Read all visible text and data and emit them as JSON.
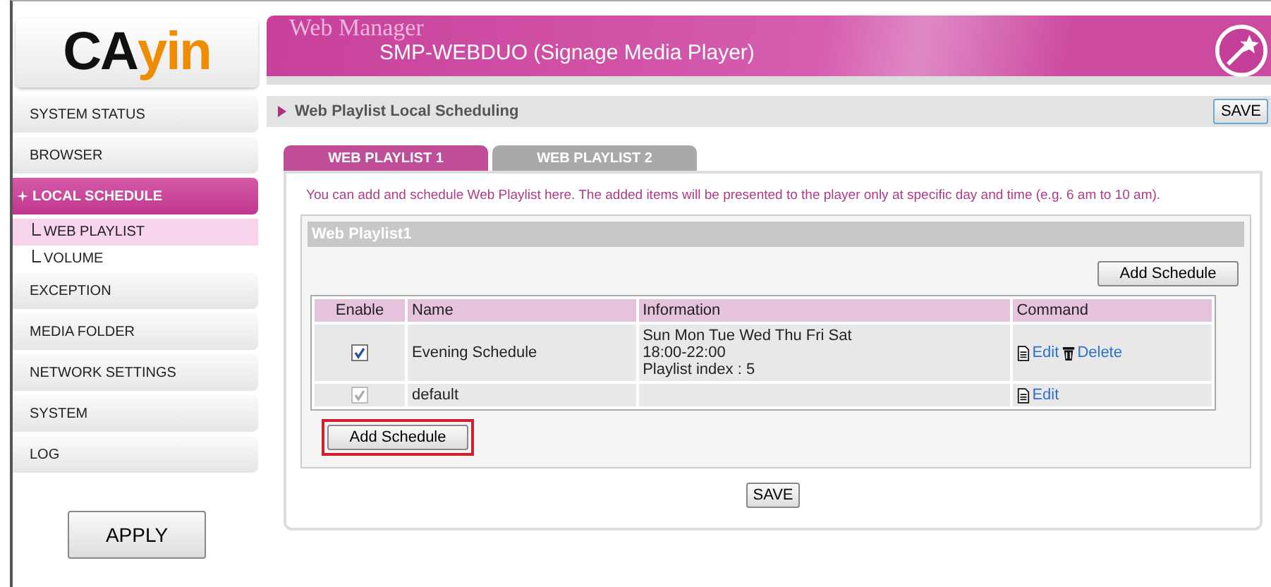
{
  "logo": {
    "parts": [
      "CA",
      "yin"
    ]
  },
  "header": {
    "title": "Web Manager",
    "subtitle": "SMP-WEBDUO (Signage Media Player)"
  },
  "sidebar": {
    "items": [
      {
        "label": "SYSTEM STATUS",
        "selected": false
      },
      {
        "label": "BROWSER",
        "selected": false
      },
      {
        "label": "LOCAL SCHEDULE",
        "selected": true,
        "children": [
          {
            "label": "WEB PLAYLIST",
            "selected": true
          },
          {
            "label": "VOLUME",
            "selected": false
          }
        ]
      },
      {
        "label": "EXCEPTION",
        "selected": false
      },
      {
        "label": "MEDIA FOLDER",
        "selected": false
      },
      {
        "label": "NETWORK SETTINGS",
        "selected": false
      },
      {
        "label": "SYSTEM",
        "selected": false
      },
      {
        "label": "LOG",
        "selected": false
      }
    ],
    "apply_button": "APPLY"
  },
  "page_title": "Web Playlist Local Scheduling",
  "top_save_button": "SAVE",
  "tabs": [
    {
      "label": "WEB PLAYLIST 1",
      "selected": true
    },
    {
      "label": "WEB PLAYLIST 2",
      "selected": false
    }
  ],
  "description": "You can add and schedule Web Playlist here. The added items will be presented to the player only at specific day and time (e.g. 6 am to 10 am).",
  "section_title": "Web Playlist1",
  "add_schedule_top": {
    "label": "Add Schedule"
  },
  "table": {
    "columns": [
      "Enable",
      "Name",
      "Information",
      "Command"
    ],
    "rows": [
      {
        "enabled": true,
        "disabled": false,
        "name": "Evening Schedule",
        "information": [
          "Sun Mon Tue Wed Thu Fri Sat",
          "18:00-22:00",
          "Playlist index : 5"
        ],
        "commands": [
          {
            "kind": "edit",
            "label": "Edit"
          },
          {
            "kind": "delete",
            "label": "Delete"
          }
        ]
      },
      {
        "enabled": true,
        "disabled": true,
        "name": "default",
        "information": [],
        "commands": [
          {
            "kind": "edit",
            "label": "Edit"
          }
        ]
      }
    ]
  },
  "add_schedule_bottom": {
    "label": "Add Schedule",
    "highlighted": true
  },
  "save_button": "SAVE"
}
